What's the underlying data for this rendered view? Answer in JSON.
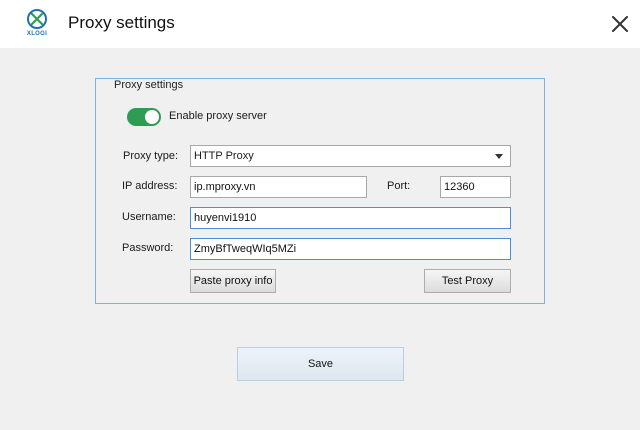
{
  "window": {
    "title": "Proxy settings",
    "logo_text": "XLOGI",
    "accent_color": "#2e9c53",
    "group_border_color": "#7fb4d8"
  },
  "proxy": {
    "group_title": "Proxy settings",
    "enable_label": "Enable proxy server",
    "enabled": true,
    "type_label": "Proxy type:",
    "type_value": "HTTP Proxy",
    "ip_label": "IP address:",
    "ip_value": "ip.mproxy.vn",
    "port_label": "Port:",
    "port_value": "12360",
    "username_label": "Username:",
    "username_value": "huyenvi1910",
    "password_label": "Password:",
    "password_value": "ZmyBfTweqWIq5MZi",
    "paste_button": "Paste proxy info",
    "test_button": "Test Proxy"
  },
  "footer": {
    "save_button": "Save"
  }
}
